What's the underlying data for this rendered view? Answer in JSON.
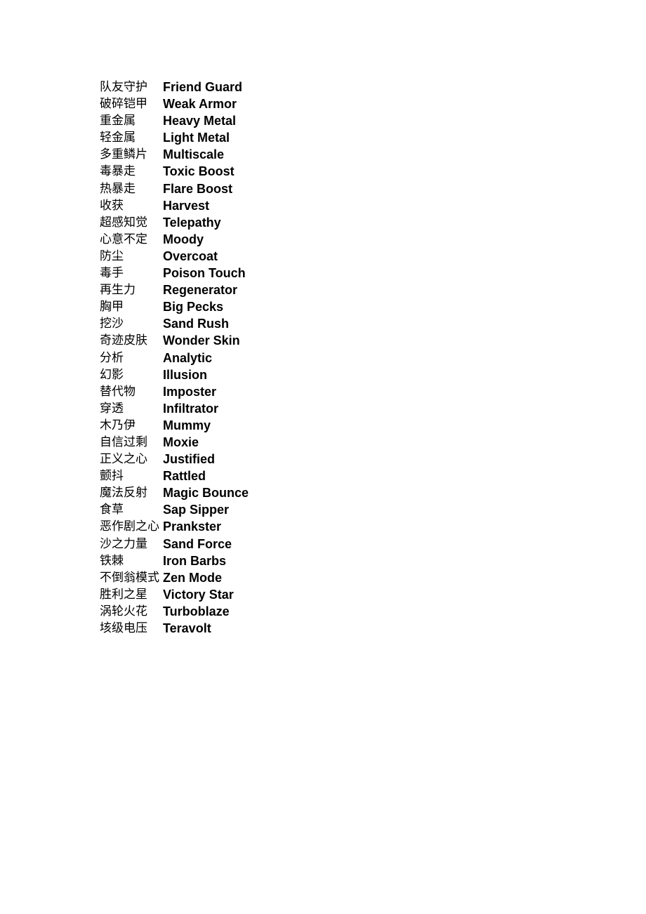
{
  "abilities": [
    {
      "zh": "队友守护",
      "en": "Friend Guard"
    },
    {
      "zh": "破碎铠甲",
      "en": "Weak Armor"
    },
    {
      "zh": "重金属",
      "en": "Heavy Metal"
    },
    {
      "zh": "轻金属",
      "en": "Light Metal"
    },
    {
      "zh": "多重鳞片",
      "en": "Multiscale"
    },
    {
      "zh": "毒暴走",
      "en": "Toxic Boost"
    },
    {
      "zh": "热暴走",
      "en": "Flare Boost"
    },
    {
      "zh": "收获",
      "en": "Harvest"
    },
    {
      "zh": "超感知觉",
      "en": "Telepathy"
    },
    {
      "zh": "心意不定",
      "en": "Moody"
    },
    {
      "zh": "防尘",
      "en": "Overcoat"
    },
    {
      "zh": "毒手",
      "en": "Poison Touch"
    },
    {
      "zh": "再生力",
      "en": "Regenerator"
    },
    {
      "zh": "胸甲",
      "en": "Big Pecks"
    },
    {
      "zh": "挖沙",
      "en": "Sand Rush"
    },
    {
      "zh": "奇迹皮肤",
      "en": "Wonder Skin"
    },
    {
      "zh": "分析",
      "en": "Analytic"
    },
    {
      "zh": "幻影",
      "en": "Illusion"
    },
    {
      "zh": "替代物",
      "en": "Imposter"
    },
    {
      "zh": "穿透",
      "en": "Infiltrator"
    },
    {
      "zh": "木乃伊",
      "en": "Mummy"
    },
    {
      "zh": "自信过剩",
      "en": "Moxie"
    },
    {
      "zh": "正义之心",
      "en": "Justified"
    },
    {
      "zh": "颤抖",
      "en": "Rattled"
    },
    {
      "zh": "魔法反射",
      "en": "Magic Bounce"
    },
    {
      "zh": "食草",
      "en": "Sap Sipper"
    },
    {
      "zh": "恶作剧之心",
      "en": "Prankster"
    },
    {
      "zh": "沙之力量",
      "en": "Sand Force"
    },
    {
      "zh": "铁棘",
      "en": "Iron Barbs"
    },
    {
      "zh": "不倒翁模式",
      "en": "Zen Mode"
    },
    {
      "zh": "胜利之星",
      "en": "Victory Star"
    },
    {
      "zh": "涡轮火花",
      "en": "Turboblaze"
    },
    {
      "zh": "垓级电压",
      "en": "Teravolt"
    }
  ]
}
